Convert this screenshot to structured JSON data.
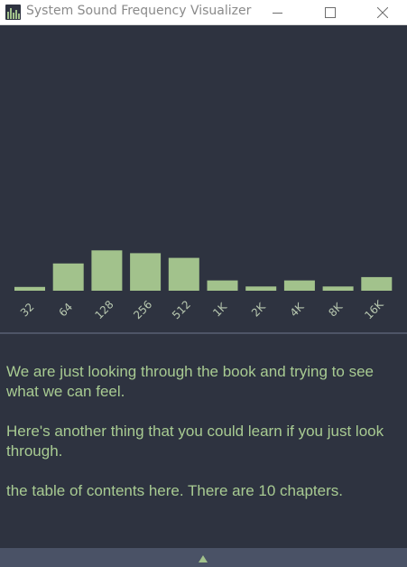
{
  "window": {
    "title": "System Sound Frequency Visualizer",
    "app_icon": "equalizer-icon",
    "controls": {
      "minimize_icon": "minimize-icon",
      "maximize_icon": "maximize-icon",
      "close_icon": "close-icon"
    }
  },
  "colors": {
    "background": "#2e3340",
    "bar": "#a2c28c",
    "text": "#a8cb92",
    "label": "#b8c8b0",
    "divider": "#4e5567",
    "bottom_bar": "#4a5266"
  },
  "chart_data": {
    "type": "bar",
    "categories": [
      "32",
      "64",
      "128",
      "256",
      "512",
      "1K",
      "2K",
      "4K",
      "8K",
      "16K"
    ],
    "values": [
      0.08,
      0.58,
      0.86,
      0.8,
      0.7,
      0.22,
      0.09,
      0.22,
      0.09,
      0.29
    ],
    "title": "",
    "xlabel": "",
    "ylabel": "",
    "ylim": [
      0,
      1
    ],
    "grid": false
  },
  "text_area": {
    "paragraphs": [
      "We are just looking through the book and trying to see what we can feel.",
      "Here's another thing that you could learn if you just look through.",
      "the table of contents here. There are 10 chapters."
    ]
  },
  "bottom_bar": {
    "expand_icon": "triangle-up-icon"
  }
}
